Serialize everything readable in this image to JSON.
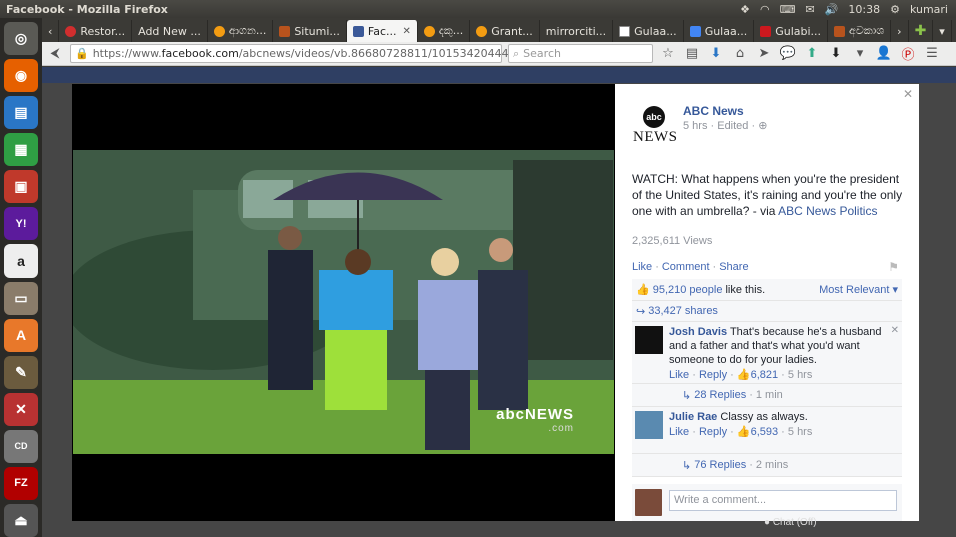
{
  "window": {
    "title": "Facebook - Mozilla Firefox"
  },
  "system_tray": {
    "time": "10:38",
    "user": "kumari"
  },
  "launcher": {
    "items": [
      "dash",
      "firefox",
      "writer",
      "calc",
      "impress",
      "yahoo-mail",
      "amazon",
      "files",
      "software-center",
      "gimp",
      "settings",
      "cd-burner",
      "filezilla",
      "usb"
    ]
  },
  "tabs": [
    {
      "label": "Restor...",
      "icon": "red"
    },
    {
      "label": "Add New ...",
      "icon": "none"
    },
    {
      "label": "ආගන...",
      "icon": "orange"
    },
    {
      "label": "Situmi...",
      "icon": "br"
    },
    {
      "label": "Fac...",
      "icon": "fb",
      "active": true
    },
    {
      "label": "දකු...",
      "icon": "orange"
    },
    {
      "label": "Grant...",
      "icon": "orange"
    },
    {
      "label": "mirrorciti...",
      "icon": "none"
    },
    {
      "label": "Gulaa...",
      "icon": "w"
    },
    {
      "label": "Gulaa...",
      "icon": "g"
    },
    {
      "label": "Gulabi...",
      "icon": "yt"
    },
    {
      "label": "අවකාශ",
      "icon": "br"
    }
  ],
  "nav": {
    "url_prefix": "https://www.",
    "url_host": "facebook.com",
    "url_path": "/abcnews/videos/vb.86680728811/10153420444463812/",
    "search_placeholder": "Search"
  },
  "post": {
    "page_name": "ABC News",
    "meta": "5 hrs · Edited · ",
    "text_main": "WATCH: What happens when you're the president of the United States, it's raining and you're the only one with an umbrella? - via ",
    "text_link": "ABC News Politics",
    "views": "2,325,611 Views",
    "actions": {
      "like": "Like",
      "comment": "Comment",
      "share": "Share"
    },
    "likes_count": "95,210 people",
    "likes_suffix": "like this.",
    "most_relevant": "Most Relevant ▾",
    "shares": "33,427 shares",
    "logo_top": "abc",
    "logo_bottom": "NEWS"
  },
  "comments": [
    {
      "author": "Josh Davis",
      "text": "That's because he's a husband and a father and that's what you'd want someone to do for your ladies.",
      "like": "Like",
      "reply": "Reply",
      "likes": "6,821",
      "time": "5 hrs",
      "replies": "28 Replies",
      "replies_time": "1 min"
    },
    {
      "author": "Julie Rae",
      "text": "Classy as always.",
      "like": "Like",
      "reply": "Reply",
      "likes": "6,593",
      "time": "5 hrs",
      "replies": "76 Replies",
      "replies_time": "2 mins"
    }
  ],
  "write_comment_placeholder": "Write a comment...",
  "video": {
    "watermark": "abcNEWS",
    "watermark_sub": ".com"
  },
  "chat": "Chat (Off)"
}
